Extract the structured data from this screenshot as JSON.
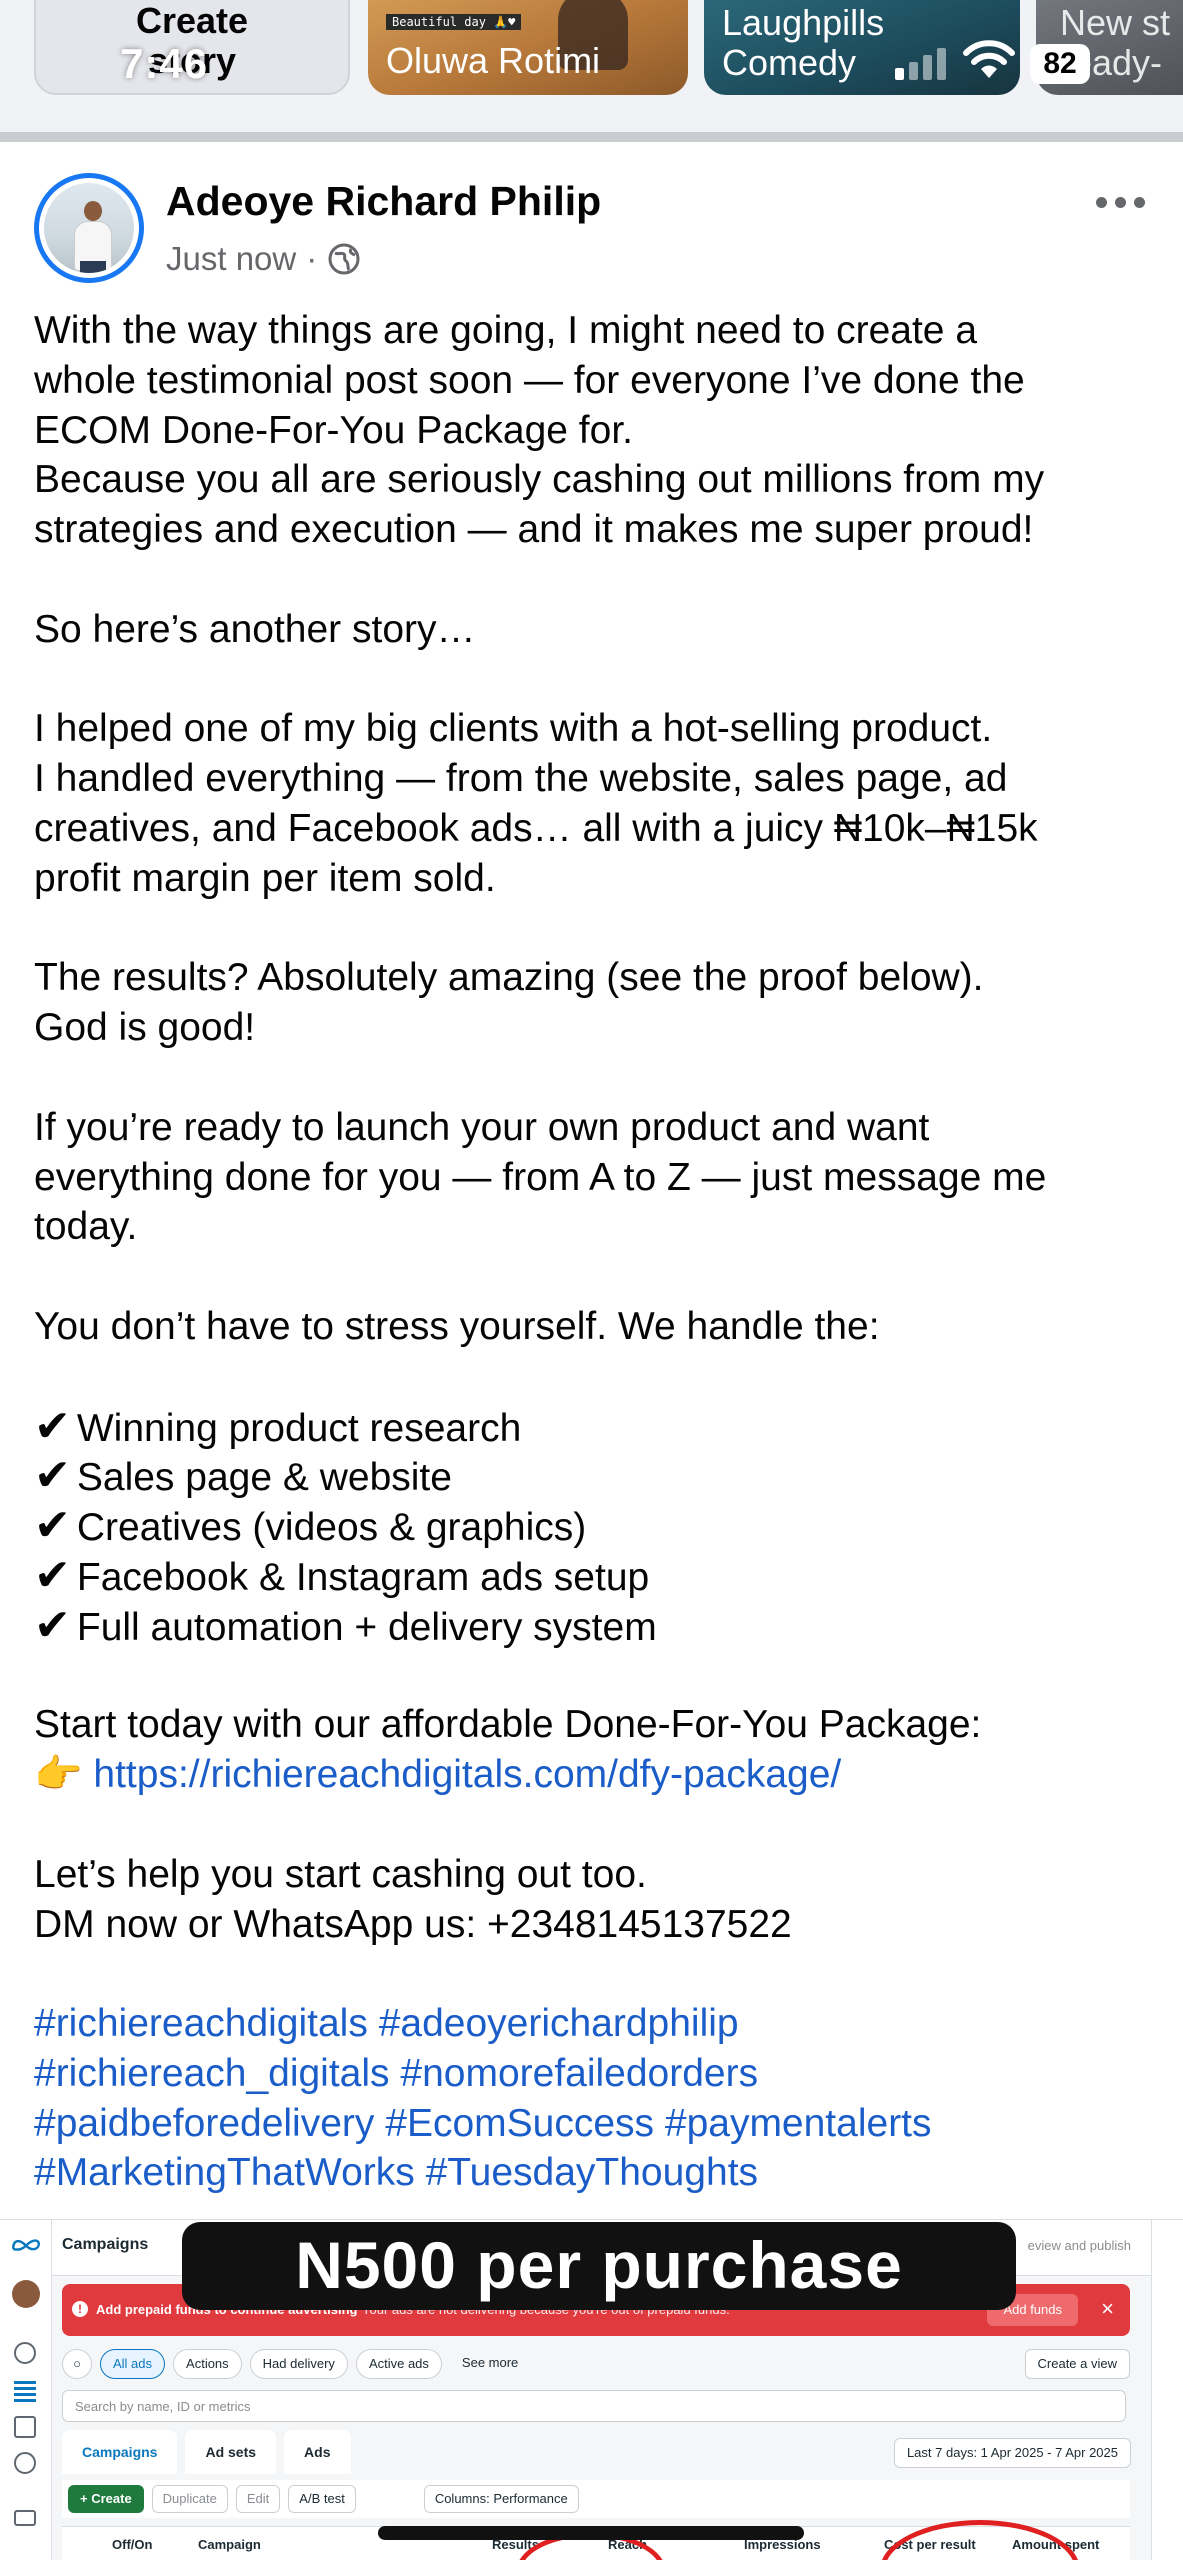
{
  "status_bar": {
    "time": "7:46",
    "battery": "82"
  },
  "stories": [
    {
      "label_line1": "Create",
      "label_line2": "story"
    },
    {
      "label": "Oluwa Rotimi",
      "banner": "Beautiful day 🙏♥"
    },
    {
      "label_line1": "Laughpills",
      "label_line2": "Comedy"
    },
    {
      "label_line1": "New st",
      "label_line2": "ready-"
    }
  ],
  "post": {
    "author": "Adeoye Richard Philip",
    "time": "Just now",
    "separator": "·",
    "lines": {
      "l1": "With the way things are going, I might need to create a",
      "l2": "whole testimonial post soon — for everyone I’ve done the",
      "l3": "ECOM Done-For-You Package for.",
      "l4": "Because you all are seriously cashing out millions from my",
      "l5": "strategies and execution — and it makes me super proud!",
      "l6": "So here’s another story…",
      "l7": "I helped one of my big clients with a hot-selling product.",
      "l8": "I handled everything — from the website, sales page, ad",
      "l9": "creatives, and Facebook ads… all with a juicy ₦10k–₦15k",
      "l10": "profit margin per item sold.",
      "l11": "The results? Absolutely amazing (see the proof below).",
      "l12": "God is good!",
      "l13": "If you’re ready to launch your own product and want",
      "l14": "everything done for you — from A to Z — just message me",
      "l15": "today.",
      "l16": "You don’t have to stress yourself. We handle the:",
      "l17": "Start today with our affordable Done-For-You Package:",
      "l18": "Let’s help you start cashing out too.",
      "l19": "DM now or WhatsApp us: +2348145137522"
    },
    "checklist": [
      "Winning product research",
      "Sales page & website",
      "Creatives (videos & graphics)",
      "Facebook & Instagram ads setup",
      "Full automation + delivery system"
    ],
    "check_glyph": "✔",
    "pointer_emoji": "👉",
    "link": "https://richiereachdigitals.com/dfy-package/",
    "hashtags": {
      "h1": "#richiereachdigitals",
      "h2": "#adeoyerichardphilip",
      "h3": "#richiereach_digitals",
      "h4": "#nomorefailedorders",
      "h5": "#paidbeforedelivery",
      "h6": "#EcomSuccess",
      "h7": "#paymentalerts",
      "h8": "#MarketingThatWorks",
      "h9": "#TuesdayThoughts"
    }
  },
  "ads_screenshot": {
    "overlay_text": "N500 per purchase",
    "title": "Campaigns",
    "review": "eview and publish",
    "alert_title": "Add prepaid funds to continue advertising",
    "alert_sub": "Your ads are not delivering because you're out of prepaid funds.",
    "add_funds": "Add funds",
    "filters": [
      "All ads",
      "Actions",
      "Had delivery",
      "Active ads",
      "See more"
    ],
    "create_view": "Create a view",
    "search_placeholder": "Search by name, ID or metrics",
    "tabs": [
      "Campaigns",
      "Ad sets",
      "Ads"
    ],
    "date_range": "Last 7 days: 1 Apr 2025 - 7 Apr 2025",
    "toolbar": {
      "create": "+ Create",
      "duplicate": "Duplicate",
      "edit": "Edit",
      "ab_test": "A/B test",
      "columns": "Columns: Performance"
    },
    "columns": [
      "Off/On",
      "Campaign",
      "Results",
      "Reach",
      "Impressions",
      "Cost per result",
      "Amount spent"
    ]
  }
}
